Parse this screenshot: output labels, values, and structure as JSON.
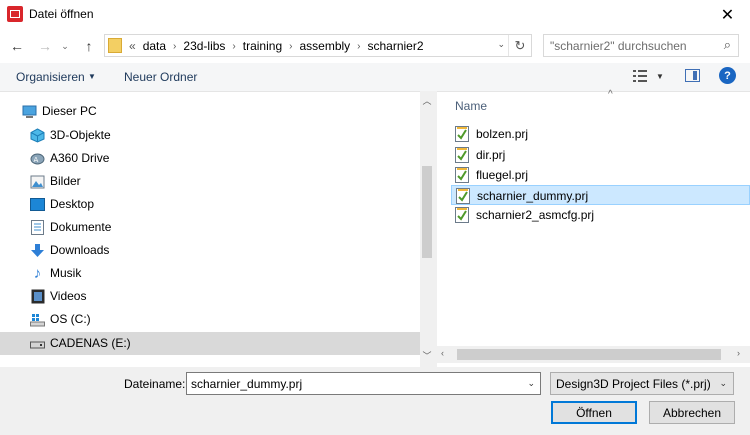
{
  "window": {
    "title": "Datei öffnen"
  },
  "address": {
    "overflow": "«",
    "crumbs": [
      "data",
      "23d-libs",
      "training",
      "assembly",
      "scharnier2"
    ]
  },
  "search": {
    "placeholder": "\"scharnier2\" durchsuchen"
  },
  "toolbar": {
    "organize": "Organisieren",
    "new_folder": "Neuer Ordner",
    "help": "?"
  },
  "nav": {
    "items": [
      {
        "label": "Dieser PC",
        "icon": "computer-icon"
      },
      {
        "label": "3D-Objekte",
        "icon": "cube-icon"
      },
      {
        "label": "A360 Drive",
        "icon": "cloud-drive-icon"
      },
      {
        "label": "Bilder",
        "icon": "pictures-icon"
      },
      {
        "label": "Desktop",
        "icon": "desktop-icon"
      },
      {
        "label": "Dokumente",
        "icon": "documents-icon"
      },
      {
        "label": "Downloads",
        "icon": "download-icon"
      },
      {
        "label": "Musik",
        "icon": "music-icon"
      },
      {
        "label": "Videos",
        "icon": "videos-icon"
      },
      {
        "label": "OS (C:)",
        "icon": "os-drive-icon"
      },
      {
        "label": "CADENAS (E:)",
        "icon": "drive-icon",
        "selected": true
      }
    ]
  },
  "files": {
    "column_name": "Name",
    "items": [
      {
        "name": "bolzen.prj"
      },
      {
        "name": "dir.prj"
      },
      {
        "name": "fluegel.prj"
      },
      {
        "name": "scharnier_dummy.prj",
        "selected": true
      },
      {
        "name": "scharnier2_asmcfg.prj"
      }
    ]
  },
  "bottom": {
    "filename_label": "Dateiname:",
    "filename_value": "scharnier_dummy.prj",
    "filetype_value": "Design3D Project Files (*.prj)",
    "open_label": "Öffnen",
    "cancel_label": "Abbrechen"
  },
  "colors": {
    "accent": "#0078d7",
    "selection": "#cce8ff",
    "nav_selected": "#d9d9d9"
  }
}
